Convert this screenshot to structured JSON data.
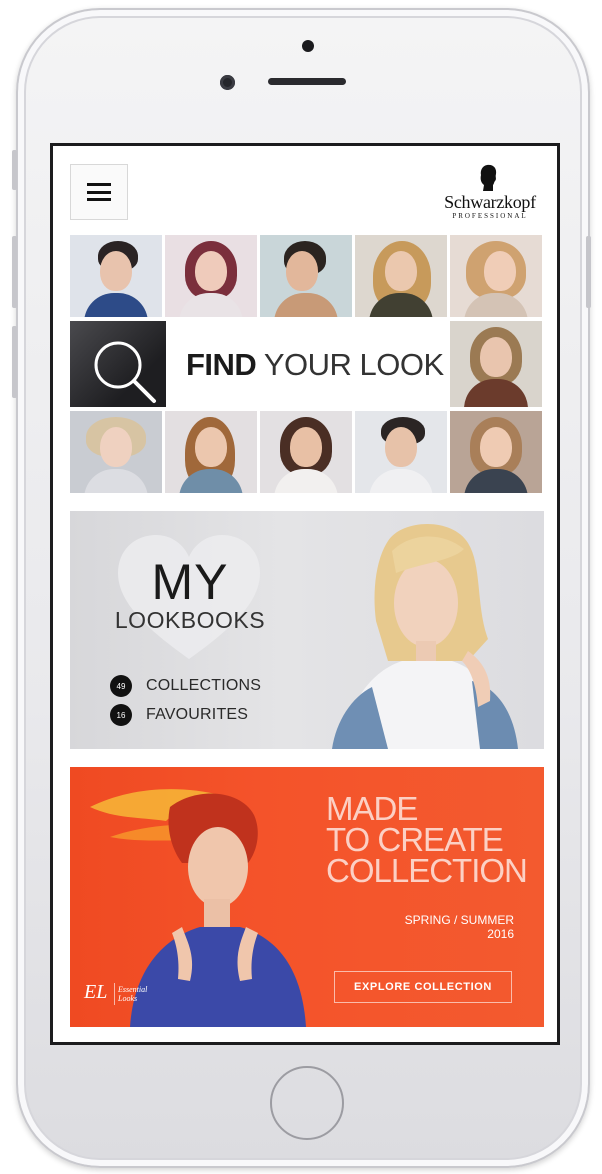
{
  "header": {
    "brand_name": "Schwarzkopf",
    "brand_sub": "PROFESSIONAL",
    "menu_icon": "hamburger-menu-icon",
    "brand_icon": "silhouette-head-icon"
  },
  "find_your_look": {
    "title_bold": "FIND",
    "title_light": " YOUR LOOK",
    "search_icon": "magnifier-icon"
  },
  "lookbooks": {
    "title_main": "MY",
    "title_sub": "LOOKBOOKS",
    "rows": [
      {
        "count": "49",
        "label": "COLLECTIONS"
      },
      {
        "count": "16",
        "label": "FAVOURITES"
      }
    ]
  },
  "campaign": {
    "title_lines": [
      "MADE",
      "TO CREATE",
      "COLLECTION"
    ],
    "season_line1": "SPRING / SUMMER",
    "season_line2": "2016",
    "button_label": "EXPLORE COLLECTION",
    "logo_mark": "EL",
    "logo_text_line1": "Essential",
    "logo_text_line2": "Looks"
  },
  "colors": {
    "campaign_orange": "#f14f26",
    "lookbook_grey": "#dedee1",
    "text_dark": "#1b1b1b"
  }
}
